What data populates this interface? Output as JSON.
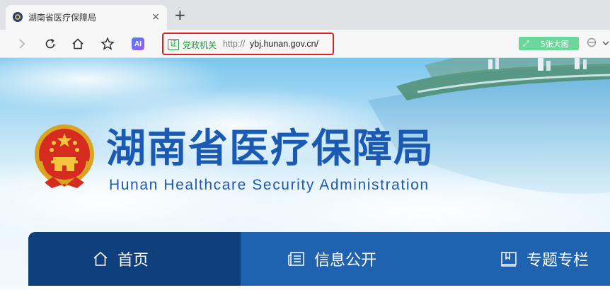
{
  "browser": {
    "tab": {
      "title": "湖南省医疗保障局",
      "close": "×"
    },
    "new_tab": "+",
    "toolbar": {
      "ai_label": "AI",
      "address": {
        "cert_badge": "证",
        "cert_label": "党政机关",
        "url_prefix": "http://",
        "url_host": "ybj.hunan.gov.cn/"
      },
      "big_image_button": "5张大图",
      "big_image_expand": "⤢"
    }
  },
  "site": {
    "title_cn": "湖南省医疗保障局",
    "title_en": "Hunan Healthcare Security Administration"
  },
  "nav": {
    "items": [
      {
        "label": "首页",
        "icon": "home-icon",
        "active": true
      },
      {
        "label": "信息公开",
        "icon": "newspaper-icon",
        "active": false
      },
      {
        "label": "专题专栏",
        "icon": "book-icon",
        "active": false
      }
    ]
  },
  "colors": {
    "brand_blue": "#1b5ab3",
    "nav_blue": "#1e62b0",
    "nav_active": "#0f3f7c",
    "cert_green": "#1e9a3c",
    "highlight_red": "#e02020"
  }
}
